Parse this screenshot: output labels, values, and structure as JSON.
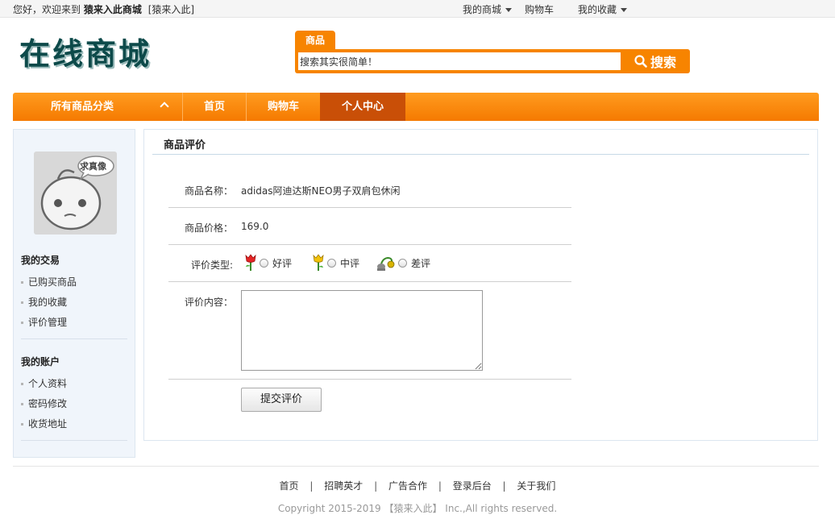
{
  "topbar": {
    "welcome_prefix": "您好，欢迎来到",
    "site_name": "猿来入此商城",
    "bracket_link": "[猿来入此]",
    "links": [
      {
        "label": "我的商城",
        "has_caret": true
      },
      {
        "label": "购物车",
        "has_caret": false
      },
      {
        "label": "我的收藏",
        "has_caret": true
      }
    ]
  },
  "header": {
    "logo_text": "在线商城",
    "search_tab": "商品",
    "search_value": "搜索其实很简单！",
    "search_button": "搜索"
  },
  "nav": {
    "category_label": "所有商品分类",
    "items": [
      {
        "label": "首页",
        "active": false
      },
      {
        "label": "购物车",
        "active": false
      },
      {
        "label": "个人中心",
        "active": true
      }
    ]
  },
  "sidebar": {
    "avatar_caption": "求真像",
    "sections": [
      {
        "title": "我的交易",
        "items": [
          "已购买商品",
          "我的收藏",
          "评价管理"
        ]
      },
      {
        "title": "我的账户",
        "items": [
          "个人资料",
          "密码修改",
          "收货地址"
        ]
      }
    ]
  },
  "main": {
    "title": "商品评价",
    "product_name_label": "商品名称：",
    "product_name": "adidas阿迪达斯NEO男子双肩包休闲",
    "product_price_label": "商品价格：",
    "product_price": "169.0",
    "rating_label": "评价类型:",
    "ratings": [
      {
        "label": "好评",
        "icon": "red-flower-icon",
        "color": "#e52525"
      },
      {
        "label": "中评",
        "icon": "yellow-flower-icon",
        "color": "#f2c20a"
      },
      {
        "label": "差评",
        "icon": "wilted-flower-icon",
        "color": "#6b8e23"
      }
    ],
    "content_label": "评价内容：",
    "content_value": "",
    "submit_label": "提交评价"
  },
  "footer": {
    "links": [
      "首页",
      "招聘英才",
      "广告合作",
      "登录后台",
      "关于我们"
    ],
    "copyright": "Copyright 2015-2019 【猿来入此】 Inc.,All rights reserved."
  },
  "colors": {
    "accent": "#f78400",
    "nav_active": "#c94f07",
    "sidebar_bg": "#f0f5fb"
  }
}
